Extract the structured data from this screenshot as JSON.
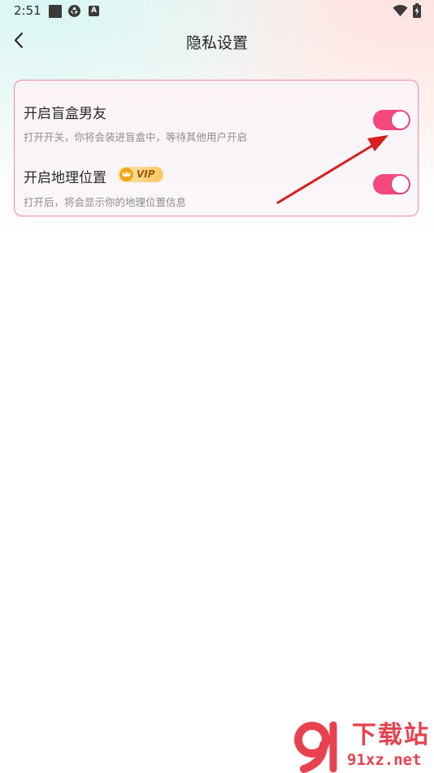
{
  "status_bar": {
    "time": "2:51",
    "icons": [
      "stop-square-icon",
      "camera-shutter-icon",
      "a-notification-icon",
      "wifi-icon",
      "battery-charging-icon"
    ],
    "a_glyph": "A"
  },
  "header": {
    "title": "隐私设置",
    "back_icon": "chevron-left-icon"
  },
  "settings": [
    {
      "title": "开启盲盒男友",
      "description": "打开开关，你将会装进盲盒中，等待其他用户开启",
      "enabled": true
    },
    {
      "title": "开启地理位置",
      "badge": "VIP",
      "description": "打开后，将会显示你的地理位置信息",
      "enabled": true
    }
  ],
  "colors": {
    "accent": "#f4487e",
    "card_border": "#f28aa1",
    "annotation_arrow": "#d81e1e",
    "watermark": "#e8414f"
  },
  "watermark": {
    "line1": "下载站",
    "line2": "91xz.net"
  }
}
